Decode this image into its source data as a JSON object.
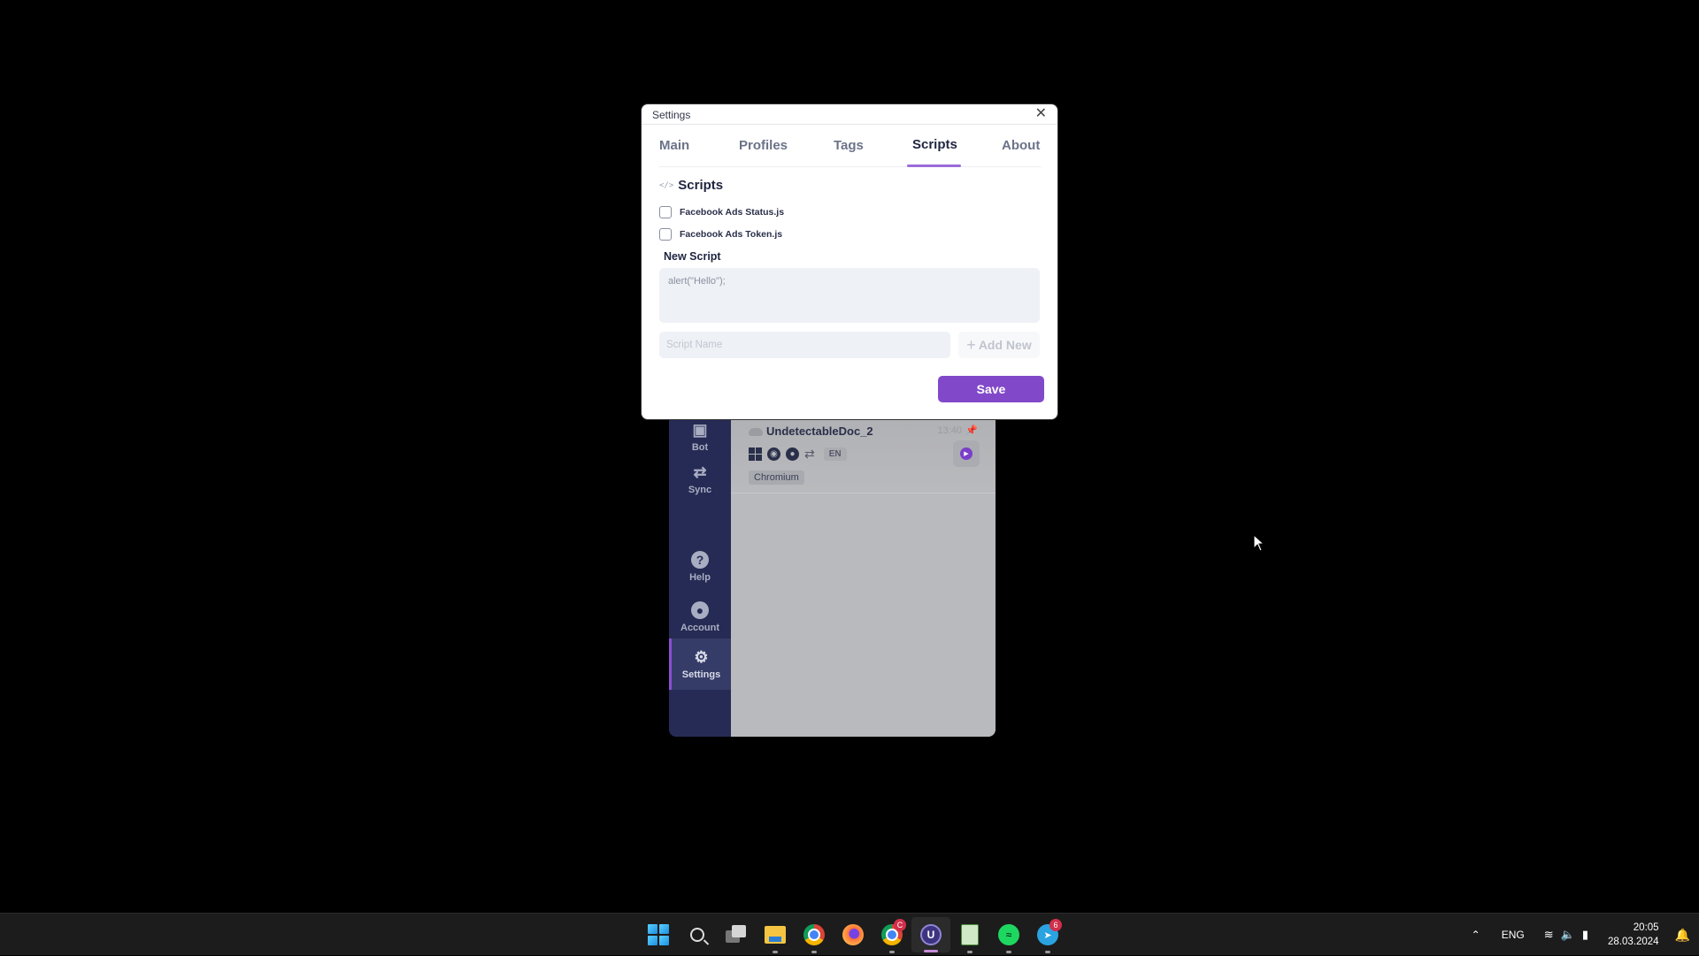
{
  "dialog": {
    "title": "Settings",
    "tabs": [
      {
        "label": "Main",
        "active": false
      },
      {
        "label": "Profiles",
        "active": false
      },
      {
        "label": "Tags",
        "active": false
      },
      {
        "label": "Scripts",
        "active": true
      },
      {
        "label": "About",
        "active": false
      }
    ],
    "section_title": "Scripts",
    "scripts": [
      {
        "name": "Facebook Ads Status.js",
        "checked": false
      },
      {
        "name": "Facebook Ads Token.js",
        "checked": false
      }
    ],
    "new_script_label": "New Script",
    "code_value": "alert(\"Hello\");",
    "script_name_placeholder": "Script Name",
    "add_new_label": "Add New",
    "save_label": "Save",
    "accent_color": "#8149c9"
  },
  "app": {
    "sidebar": [
      {
        "label": "Bot",
        "icon": "robot-icon"
      },
      {
        "label": "Sync",
        "icon": "sync-icon"
      },
      {
        "label": "Help",
        "icon": "help-icon"
      },
      {
        "label": "Account",
        "icon": "account-icon"
      },
      {
        "label": "Settings",
        "icon": "gear-icon",
        "active": true
      }
    ],
    "profile": {
      "name": "UndetectableDoc_2",
      "time": "13:40",
      "language": "EN",
      "browser": "Chromium"
    }
  },
  "taskbar": {
    "apps": [
      {
        "name": "Start",
        "icon": "windows-start-icon"
      },
      {
        "name": "Search",
        "icon": "search-icon"
      },
      {
        "name": "Task View",
        "icon": "task-view-icon"
      },
      {
        "name": "File Explorer",
        "icon": "folder-icon"
      },
      {
        "name": "Google Chrome",
        "icon": "chrome-icon"
      },
      {
        "name": "Firefox",
        "icon": "firefox-icon"
      },
      {
        "name": "Chrome Profile",
        "icon": "chrome-icon",
        "badge": "C"
      },
      {
        "name": "Undetectable",
        "icon": "undetectable-icon",
        "active": true
      },
      {
        "name": "Notepad++",
        "icon": "notepad-icon"
      },
      {
        "name": "Spotify",
        "icon": "spotify-icon"
      },
      {
        "name": "Telegram",
        "icon": "telegram-icon",
        "badge": "6"
      }
    ],
    "tray": {
      "language": "ENG",
      "time": "20:05",
      "date": "28.03.2024"
    }
  }
}
